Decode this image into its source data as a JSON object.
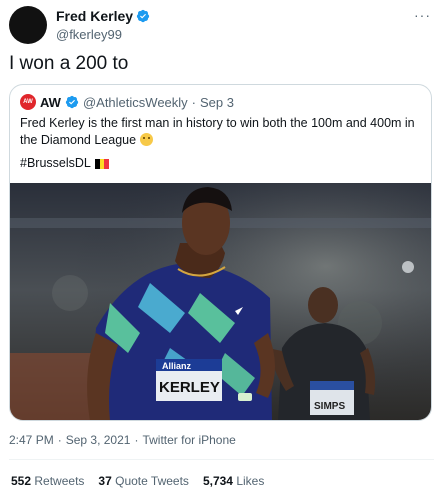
{
  "author": {
    "name": "Fred Kerley",
    "handle": "@fkerley99"
  },
  "tweet": {
    "text": "I won a 200 to"
  },
  "quoted": {
    "logo_text": "AW",
    "name": "AW",
    "handle": "@AthleticsWeekly",
    "separator": "·",
    "date": "Sep 3",
    "text": "Fred Kerley is the first man in history to win both the 100m and 400m in the Diamond League",
    "hashtag": "#BrusselsDL",
    "photo_bib": {
      "sponsor": "Allianz",
      "name": "KERLEY",
      "runner2": "SIMPS"
    }
  },
  "meta": {
    "time": "2:47 PM",
    "sep1": "·",
    "date": "Sep 3, 2021",
    "sep2": "·",
    "client": "Twitter for iPhone"
  },
  "stats": {
    "retweets_count": "552",
    "retweets_label": "Retweets",
    "quotes_count": "37",
    "quotes_label": "Quote Tweets",
    "likes_count": "5,734",
    "likes_label": "Likes"
  },
  "colors": {
    "verified": "#1d9bf0",
    "muted": "#536471",
    "border": "#cfd9de",
    "aw_red": "#e0262b"
  },
  "icons": {
    "verified": "verified-badge-icon",
    "more": "more-icon",
    "flag": "belgium-flag-icon",
    "emoji": "astonished-face-icon"
  }
}
